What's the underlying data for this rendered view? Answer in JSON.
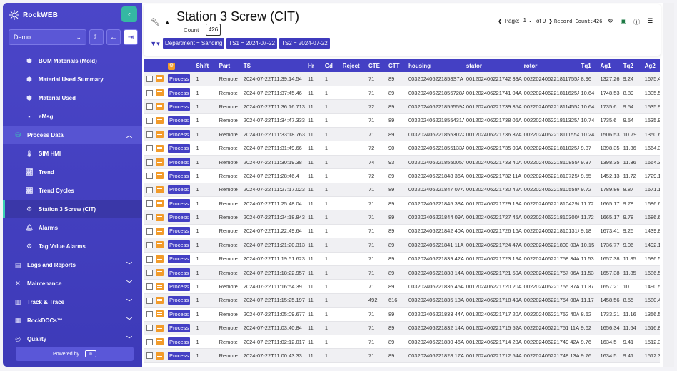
{
  "app": {
    "brand": "RockWEB",
    "database": "Demo",
    "powered_by": "Powered by"
  },
  "colors": {
    "sidebar": "#4b46c8",
    "accent": "#39d0b4",
    "primary": "#4440c4",
    "note": "#f29b2a"
  },
  "nav": [
    {
      "label": "BOM Materials (Mold)",
      "icon": "cubes-icon",
      "kind": "sub"
    },
    {
      "label": "Material Used Summary",
      "icon": "cubes-icon",
      "kind": "sub"
    },
    {
      "label": "Material Used",
      "icon": "cubes-icon",
      "kind": "sub"
    },
    {
      "label": "eMsg",
      "icon": "message-icon",
      "kind": "sub"
    },
    {
      "label": "Process Data",
      "icon": "database-icon",
      "kind": "section"
    },
    {
      "label": "SIM HMI",
      "icon": "thermometer-icon",
      "kind": "sub"
    },
    {
      "label": "Trend",
      "icon": "chart-line-icon",
      "kind": "sub"
    },
    {
      "label": "Trend Cycles",
      "icon": "chart-line-icon",
      "kind": "sub"
    },
    {
      "label": "Station 3 Screw (CIT)",
      "icon": "gear-icon",
      "kind": "active"
    },
    {
      "label": "Alarms",
      "icon": "bell-icon",
      "kind": "sub"
    },
    {
      "label": "Tag Value Alarms",
      "icon": "cogs-icon",
      "kind": "sub"
    },
    {
      "label": "Logs and Reports",
      "icon": "report-icon",
      "kind": "top"
    },
    {
      "label": "Maintenance",
      "icon": "tools-icon",
      "kind": "top"
    },
    {
      "label": "Track & Trace",
      "icon": "barcode-icon",
      "kind": "top"
    },
    {
      "label": "RockDOCs™",
      "icon": "docs-icon",
      "kind": "top"
    },
    {
      "label": "Quality",
      "icon": "quality-icon",
      "kind": "top"
    }
  ],
  "page": {
    "title": "Station 3 Screw (CIT)",
    "count_label": "Count",
    "count_value": "426",
    "filters": [
      "Department = Sanding",
      "TS1 = 2024-07-22",
      "TS2 = 2024-07-22"
    ],
    "pager": {
      "prefix": "Page:",
      "current": "1",
      "of": "of 9"
    },
    "record_count": "Record Count:426"
  },
  "table": {
    "process_label": "Process",
    "columns": [
      "Shift",
      "Part",
      "TS",
      "Hr",
      "Gd",
      "Reject",
      "CTE",
      "CTT",
      "housing",
      "stator",
      "rotor",
      "Tq1",
      "Ag1",
      "Tq2",
      "Ag2",
      "Tq3"
    ],
    "rows": [
      [
        "1",
        "Remote",
        "2024-07-22T11:39:14.54",
        "11",
        "1",
        "",
        "71",
        "89",
        "003202406221858S7A",
        "001202406221742 33A",
        "002202406221811755A",
        "8.96",
        "1327.26",
        "9.24",
        "1675.42",
        "9.8"
      ],
      [
        "1",
        "Remote",
        "2024-07-22T11:37:45.46",
        "11",
        "1",
        "",
        "71",
        "89",
        "003202406221855728A",
        "001202406221741 04A",
        "002202406221811625A",
        "10.64",
        "1748.53",
        "8.89",
        "1305.54",
        "11.5"
      ],
      [
        "1",
        "Remote",
        "2024-07-22T11:36:16.713",
        "11",
        "1",
        "",
        "72",
        "89",
        "003202406221855559A",
        "001202406221739 35A",
        "002202406221811455A",
        "10.64",
        "1735.6",
        "9.54",
        "1535.92",
        "9.2"
      ],
      [
        "1",
        "Remote",
        "2024-07-22T11:34:47.333",
        "11",
        "1",
        "",
        "71",
        "89",
        "003202406221855431A",
        "001202406221738 06A",
        "002202406221811325A",
        "10.74",
        "1735.6",
        "9.54",
        "1535.92",
        "9.2"
      ],
      [
        "1",
        "Remote",
        "2024-07-22T11:33:18.763",
        "11",
        "1",
        "",
        "71",
        "89",
        "003202406221855302A",
        "001202406221736 37A",
        "002202406221811155A",
        "10.24",
        "1506.53",
        "10.79",
        "1350.64",
        "10.7"
      ],
      [
        "1",
        "Remote",
        "2024-07-22T11:31:49.66",
        "11",
        "1",
        "",
        "72",
        "90",
        "003202406221855133A",
        "001202406221735 09A",
        "002202406221811025A",
        "9.37",
        "1398.35",
        "11.36",
        "1664.32",
        "11.6"
      ],
      [
        "1",
        "Remote",
        "2024-07-22T11:30:19.38",
        "11",
        "1",
        "",
        "74",
        "93",
        "003202406221855005A",
        "001202406221733 40A",
        "002202406221810855A",
        "9.37",
        "1398.35",
        "11.36",
        "1664.32",
        "11.6"
      ],
      [
        "1",
        "Remote",
        "2024-07-22T11:28:46.4",
        "11",
        "1",
        "",
        "72",
        "89",
        "003202406221848 36A",
        "001202406221732 11A",
        "002202406221810725A",
        "9.55",
        "1452.13",
        "11.72",
        "1729.16",
        "11.5"
      ],
      [
        "1",
        "Remote",
        "2024-07-22T11:27:17.023",
        "11",
        "1",
        "",
        "71",
        "89",
        "003202406221847 07A",
        "001202406221730 42A",
        "002202406221810558A",
        "9.72",
        "1789.86",
        "8.87",
        "1671.11",
        "10.8"
      ],
      [
        "1",
        "Remote",
        "2024-07-22T11:25:48.04",
        "11",
        "1",
        "",
        "71",
        "89",
        "003202406221845 38A",
        "001202406221729 13A",
        "002202406221810429A",
        "11.72",
        "1665.17",
        "9.78",
        "1686.68",
        "9.78"
      ],
      [
        "1",
        "Remote",
        "2024-07-22T11:24:18.843",
        "11",
        "1",
        "",
        "71",
        "89",
        "003202406221844 09A",
        "001202406221727 45A",
        "002202406221810300A",
        "11.72",
        "1665.17",
        "9.78",
        "1686.68",
        "9.78"
      ],
      [
        "1",
        "Remote",
        "2024-07-22T11:22:49.64",
        "11",
        "1",
        "",
        "71",
        "89",
        "003202406221842 40A",
        "001202406221726 16A",
        "002202406221810131A",
        "9.18",
        "1673.41",
        "9.25",
        "1439.88",
        "11.5"
      ],
      [
        "1",
        "Remote",
        "2024-07-22T11:21:20.313",
        "11",
        "1",
        "",
        "71",
        "89",
        "003202406221841 11A",
        "001202406221724 47A",
        "002202406221800 03A",
        "10.15",
        "1736.77",
        "9.06",
        "1492.14",
        "8.6"
      ],
      [
        "1",
        "Remote",
        "2024-07-22T11:19:51.623",
        "11",
        "1",
        "",
        "71",
        "89",
        "003202406221839 42A",
        "001202406221723 19A",
        "002202406221758 34A",
        "11.53",
        "1657.38",
        "11.85",
        "1686.56",
        "10.9"
      ],
      [
        "1",
        "Remote",
        "2024-07-22T11:18:22.957",
        "11",
        "1",
        "",
        "71",
        "89",
        "003202406221838 14A",
        "001202406221721 50A",
        "002202406221757 06A",
        "11.53",
        "1657.38",
        "11.85",
        "1686.56",
        "10.9"
      ],
      [
        "1",
        "Remote",
        "2024-07-22T11:16:54.39",
        "11",
        "1",
        "",
        "71",
        "89",
        "003202406221836 45A",
        "001202406221720 20A",
        "002202406221755 37A",
        "11.37",
        "1657.21",
        "10",
        "1490.57",
        "11.3"
      ],
      [
        "1",
        "Remote",
        "2024-07-22T11:15:25.197",
        "11",
        "1",
        "",
        "492",
        "616",
        "003202406221835 13A",
        "001202406221718 49A",
        "002202406221754 08A",
        "11.17",
        "1458.56",
        "8.55",
        "1580.43",
        "10.9"
      ],
      [
        "1",
        "Remote",
        "2024-07-22T11:05:09.677",
        "11",
        "1",
        "",
        "71",
        "89",
        "003202406221833 44A",
        "001202406221717 20A",
        "002202406221752 40A",
        "8.62",
        "1733.21",
        "11.16",
        "1356.57",
        "11.9"
      ],
      [
        "1",
        "Remote",
        "2024-07-22T11:03:40.84",
        "11",
        "1",
        "",
        "71",
        "89",
        "003202406221832 14A",
        "001202406221715 52A",
        "002202406221751 11A",
        "9.62",
        "1656.34",
        "11.64",
        "1516.82",
        "10.8"
      ],
      [
        "1",
        "Remote",
        "2024-07-22T11:02:12.017",
        "11",
        "1",
        "",
        "71",
        "89",
        "003202406221830 46A",
        "001202406221714 23A",
        "002202406221749 42A",
        "9.76",
        "1634.5",
        "9.41",
        "1512.33",
        "8.7"
      ],
      [
        "1",
        "Remote",
        "2024-07-22T11:00:43.33",
        "11",
        "1",
        "",
        "71",
        "89",
        "003202406221828 17A",
        "001202406221712 54A",
        "002202406221748 13A",
        "9.76",
        "1634.5",
        "9.41",
        "1512.33",
        "8.7"
      ]
    ]
  }
}
